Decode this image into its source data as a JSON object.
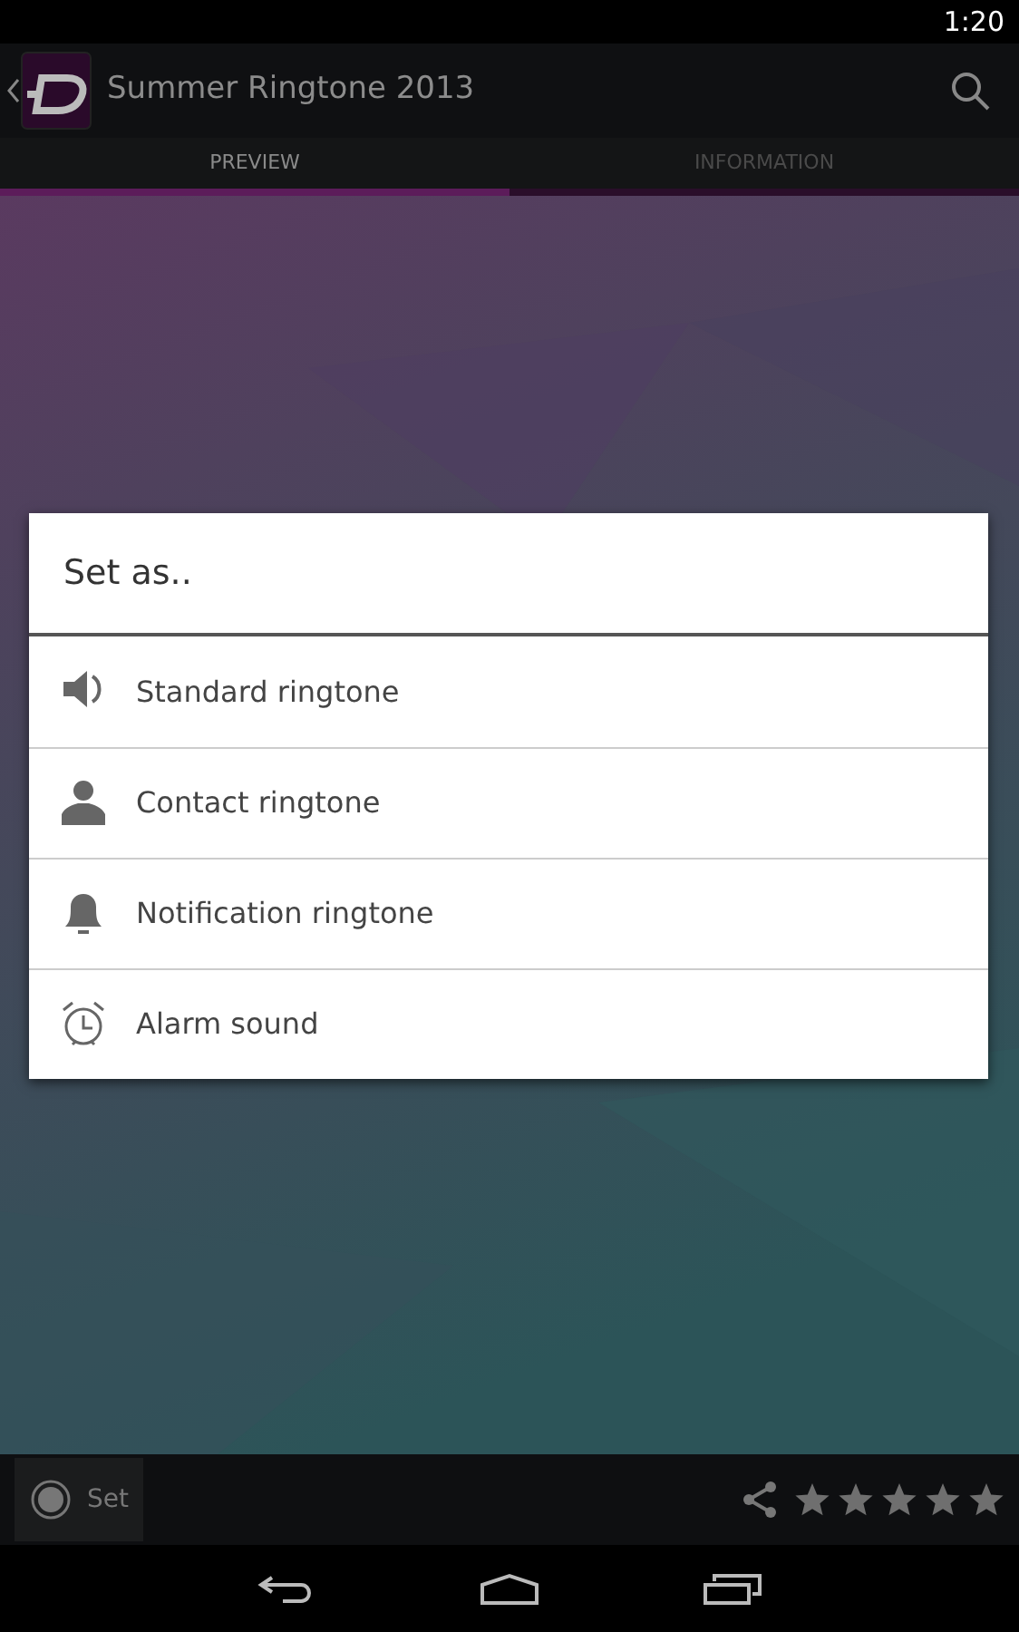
{
  "status_bar": {
    "time": "1:20"
  },
  "app_bar": {
    "title": "Summer Ringtone 2013"
  },
  "tabs": [
    {
      "label": "PREVIEW",
      "selected": true
    },
    {
      "label": "INFORMATION",
      "selected": false
    }
  ],
  "dialog": {
    "title": "Set as..",
    "items": [
      {
        "kind": "speaker",
        "label": "Standard ringtone"
      },
      {
        "kind": "person",
        "label": "Contact ringtone"
      },
      {
        "kind": "bell",
        "label": "Notification ringtone"
      },
      {
        "kind": "alarm",
        "label": "Alarm sound"
      }
    ]
  },
  "bottom_bar": {
    "set_button": "Set",
    "stars": 5
  }
}
